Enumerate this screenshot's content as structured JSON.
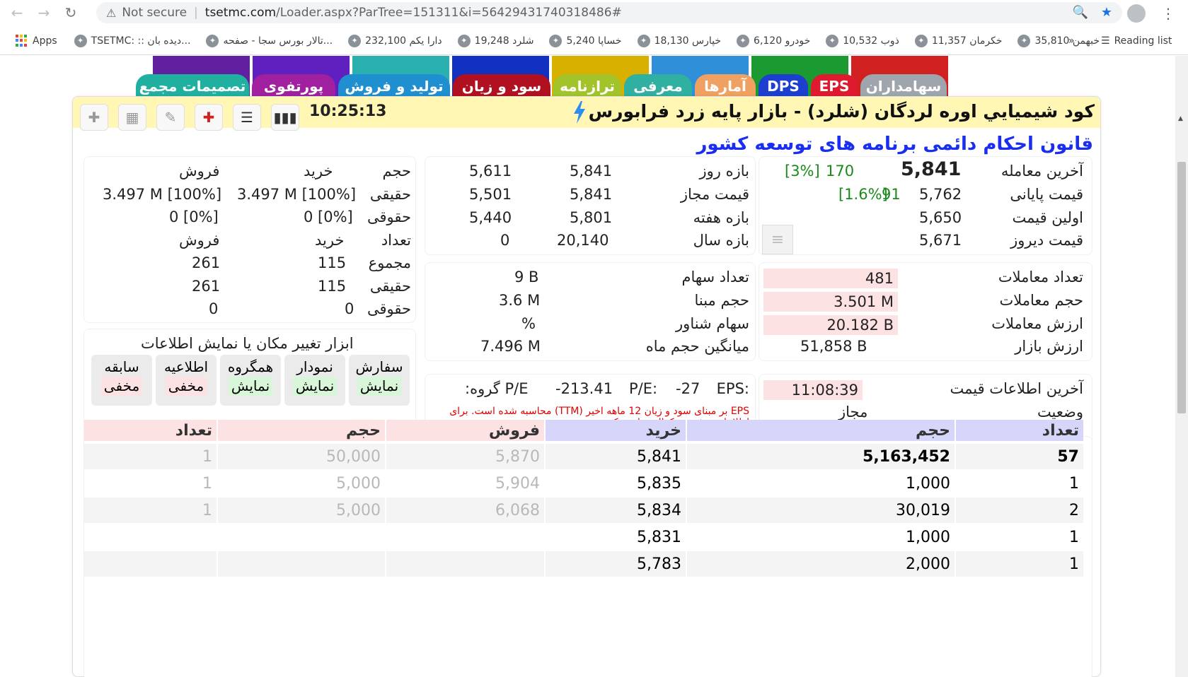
{
  "browser": {
    "not_secure": "Not secure",
    "url_host": "tsetmc.com",
    "url_path": "/Loader.aspx?ParTree=151311&i=56429431740318486#",
    "apps_label": "Apps",
    "reading_list": "Reading list",
    "bookmarks": [
      "TSETMC: :: دیده بان...",
      "تالار بورس سجا - صفحه...",
      "دارا یکم 232,100",
      "شلرد 19,248",
      "خساپا 5,240",
      "خپارس 18,130",
      "خودرو 6,120",
      "ذوب 10,532",
      "خکرمان 11,357",
      "خبهمن 35,810"
    ],
    "more": "»"
  },
  "tabs": [
    {
      "label": "سهامداران",
      "color": "#9ea5ad"
    },
    {
      "label": "EPS",
      "color": "#e01a2e"
    },
    {
      "label": "DPS",
      "color": "#1c3fd0"
    },
    {
      "label": "آمارها",
      "color": "#f0a060"
    },
    {
      "label": "معرفی",
      "color": "#2fb0a0"
    },
    {
      "label": "ترازنامه",
      "color": "#a2c42a"
    },
    {
      "label": "سود و زیان",
      "color": "#b01020"
    },
    {
      "label": "تولید و فروش",
      "color": "#1f8fd0"
    },
    {
      "label": "پورتفوی",
      "color": "#a020a0"
    },
    {
      "label": "تصمیمات مجمع",
      "color": "#20b0a0"
    }
  ],
  "tab_strip_colors": [
    "#d02020",
    "#1a9a30",
    "#2f8fd8",
    "#d8b000",
    "#1030c0",
    "#2bb0b0",
    "#6020c0",
    "#6020a0"
  ],
  "header": {
    "title": "کود شیمیايي اوره لردگان (شلرد) - بازار پایه زرد فرابورس",
    "time": "10:25:13",
    "subtitle": "قانون احکام دائمی برنامه های توسعه کشور"
  },
  "price": {
    "last_trade_label": "آخرین معامله",
    "last_trade": "5,841",
    "last_trade_change": "170",
    "last_trade_pct": "[3%]",
    "close_label": "قیمت پایانی",
    "close": "5,762",
    "close_change": "91",
    "close_pct": "[1.6%]",
    "first_label": "اولین قیمت",
    "first": "5,650",
    "yesterday_label": "قیمت دیروز",
    "yesterday": "5,671"
  },
  "ranges": {
    "day_label": "بازه روز",
    "day_high": "5,841",
    "day_low": "5,611",
    "allowed_label": "قیمت مجاز",
    "allowed_high": "5,841",
    "allowed_low": "5,501",
    "week_label": "بازه هفته",
    "week_high": "5,801",
    "week_low": "5,440",
    "year_label": "بازه سال",
    "year_high": "20,140",
    "year_low": "0"
  },
  "investors": {
    "col_vol": "حجم",
    "col_buy": "خرید",
    "col_sell": "فروش",
    "real_label": "حقیقی",
    "real_buy": "3.497 M [100%]",
    "real_sell": "3.497 M [100%]",
    "legal_label": "حقوقی",
    "legal_buy": "0 [0%]",
    "legal_sell": "0 [0%]",
    "col_count": "تعداد",
    "total_label": "مجموع",
    "total_buy": "115",
    "total_sell": "261",
    "real_count_buy": "115",
    "real_count_sell": "261",
    "legal_count_buy": "0",
    "legal_count_sell": "0"
  },
  "trades": {
    "count_label": "تعداد معاملات",
    "count": "481",
    "volume_label": "حجم معاملات",
    "volume": "3.501 M",
    "value_label": "ارزش معاملات",
    "value": "20.182 B",
    "market_label": "ارزش بازار",
    "market": "51,858 B"
  },
  "shares": {
    "count_label": "تعداد سهام",
    "count": "9 B",
    "base_label": "حجم مبنا",
    "base": "3.6 M",
    "float_label": "سهام شناور",
    "float": "%",
    "month_avg_label": "میانگین حجم ماه",
    "month_avg": "7.496 M"
  },
  "tools": {
    "title": "ابزار تغییر مکان یا نمایش اطلاعات",
    "buttons": [
      {
        "label": "سفارش",
        "state": "نمایش",
        "on": true
      },
      {
        "label": "نمودار",
        "state": "نمایش",
        "on": true
      },
      {
        "label": "همگروه",
        "state": "نمایش",
        "on": true
      },
      {
        "label": "اطلاعیه",
        "state": "مخفی",
        "on": false
      },
      {
        "label": "سابقه",
        "state": "مخفی",
        "on": false
      }
    ]
  },
  "info": {
    "last_update_label": "آخرین اطلاعات قیمت",
    "last_update": "11:08:39",
    "status_label": "وضعیت",
    "status": "مجاز",
    "eps_label": "EPS:",
    "eps": "-27",
    "pe_label": "P/E:",
    "pe": "-213.41",
    "group_pe_label": "P/E گروه:",
    "eps_note_line1": "EPS بر مبنای سود و زیان 12 ماهه اخیر (TTM) محاسبه شده است. برای",
    "eps_note_line2": "اطلاعات بیشتر به کدال مراجعه کنید."
  },
  "orderbook": {
    "headers": {
      "buy_count": "تعداد",
      "buy_vol": "حجم",
      "buy_price": "خرید",
      "sell_price": "فروش",
      "sell_vol": "حجم",
      "sell_count": "تعداد"
    },
    "rows": [
      {
        "buy_count": "57",
        "buy_vol": "5,163,452",
        "buy_price": "5,841",
        "sell_price": "5,870",
        "sell_vol": "50,000",
        "sell_count": "1"
      },
      {
        "buy_count": "1",
        "buy_vol": "1,000",
        "buy_price": "5,835",
        "sell_price": "5,904",
        "sell_vol": "5,000",
        "sell_count": "1"
      },
      {
        "buy_count": "2",
        "buy_vol": "30,019",
        "buy_price": "5,834",
        "sell_price": "6,068",
        "sell_vol": "5,000",
        "sell_count": "1"
      },
      {
        "buy_count": "1",
        "buy_vol": "1,000",
        "buy_price": "5,831",
        "sell_price": "",
        "sell_vol": "",
        "sell_count": ""
      },
      {
        "buy_count": "1",
        "buy_vol": "2,000",
        "buy_price": "5,783",
        "sell_price": "",
        "sell_vol": "",
        "sell_count": ""
      }
    ]
  }
}
